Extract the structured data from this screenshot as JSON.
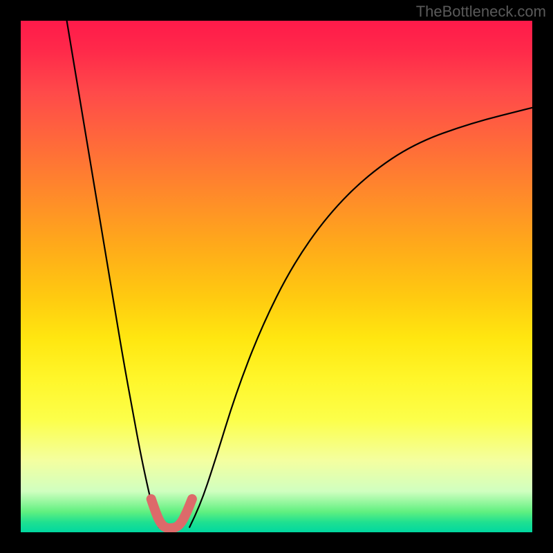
{
  "watermark": "TheBottleneck.com",
  "chart_data": {
    "type": "line",
    "title": "",
    "xlabel": "",
    "ylabel": "",
    "xlim": [
      0,
      100
    ],
    "ylim": [
      0,
      100
    ],
    "annotations": [],
    "series": [
      {
        "name": "left-descending-curve",
        "color": "#000000",
        "x": [
          9,
          12,
          15,
          18,
          20,
          22,
          23.5,
          25,
          26,
          27
        ],
        "y": [
          100,
          82,
          64,
          46,
          34,
          23,
          15,
          8,
          4,
          1
        ]
      },
      {
        "name": "right-ascending-curve",
        "color": "#000000",
        "x": [
          33,
          35,
          38,
          42,
          47,
          53,
          60,
          68,
          77,
          88,
          100
        ],
        "y": [
          1,
          5,
          14,
          27,
          40,
          52,
          62,
          70,
          76,
          80,
          83
        ]
      },
      {
        "name": "valley-highlight",
        "color": "#dd6a6a",
        "x": [
          25.5,
          26.5,
          27.5,
          28.5,
          29.5,
          30.5,
          31.5,
          32.5,
          33.5
        ],
        "y": [
          6.5,
          3.5,
          1.5,
          0.8,
          0.8,
          1.0,
          2.0,
          4.0,
          6.5
        ]
      }
    ],
    "gradient_bands": [
      {
        "pos": 0,
        "color": "#ff1a4a"
      },
      {
        "pos": 50,
        "color": "#ffcc10"
      },
      {
        "pos": 80,
        "color": "#fdff50"
      },
      {
        "pos": 100,
        "color": "#00d8a0"
      }
    ]
  }
}
